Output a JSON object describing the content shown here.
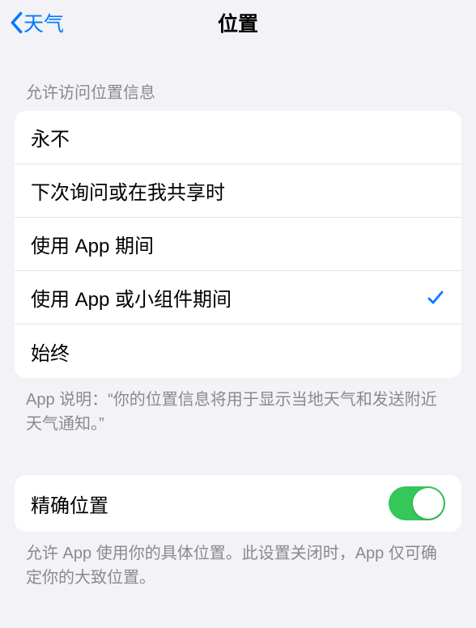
{
  "nav": {
    "back_label": "天气",
    "title": "位置"
  },
  "section1": {
    "header": "允许访问位置信息",
    "options": [
      {
        "label": "永不",
        "selected": false
      },
      {
        "label": "下次询问或在我共享时",
        "selected": false
      },
      {
        "label": "使用 App 期间",
        "selected": false
      },
      {
        "label": "使用 App 或小组件期间",
        "selected": true
      },
      {
        "label": "始终",
        "selected": false
      }
    ],
    "footer": "App 说明：“你的位置信息将用于显示当地天气和发送附近天气通知。”"
  },
  "section2": {
    "precise_label": "精确位置",
    "precise_enabled": true,
    "footer": "允许 App 使用你的具体位置。此设置关闭时，App 仅可确定你的大致位置。"
  }
}
